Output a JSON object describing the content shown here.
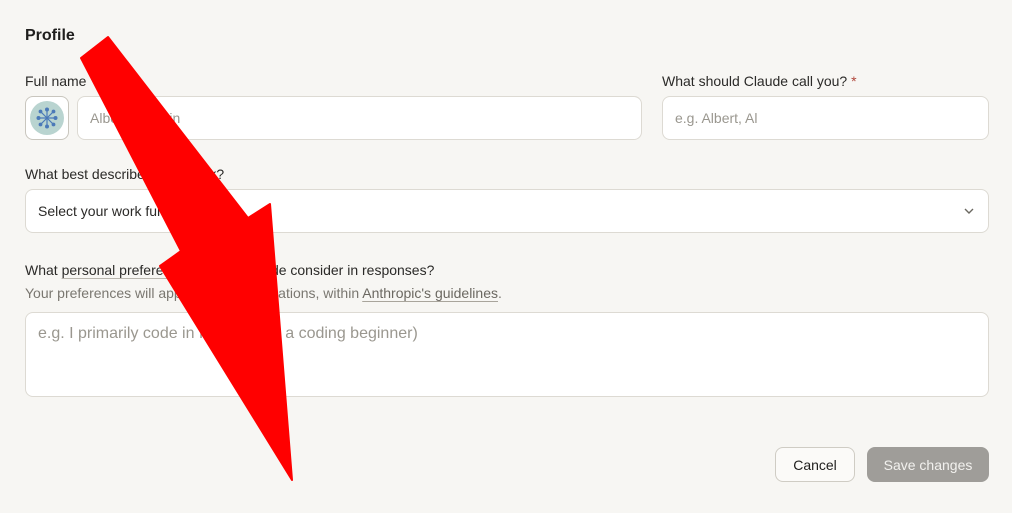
{
  "profile": {
    "section_title": "Profile",
    "full_name": {
      "label": "Full name",
      "placeholder": "Albert Einstein"
    },
    "nickname": {
      "label": "What should Claude call you?",
      "required_marker": "*",
      "placeholder": "e.g. Albert, Al"
    },
    "work": {
      "label": "What best describes your work?",
      "selected": "Select your work function"
    },
    "preferences": {
      "label_prefix": "What",
      "label_link": "personal preferences",
      "label_suffix": "should Claude consider in responses?",
      "sub_prefix": "Your preferences will apply to all conversations, within",
      "sub_link": "Anthropic's guidelines",
      "sub_suffix": ".",
      "placeholder": "e.g. I primarily code in Python (not a coding beginner)"
    },
    "actions": {
      "cancel": "Cancel",
      "save": "Save changes"
    }
  },
  "colors": {
    "annotation_arrow": "#ff0000",
    "avatar_bg": "#b9d4d0",
    "required": "#b0463b"
  }
}
